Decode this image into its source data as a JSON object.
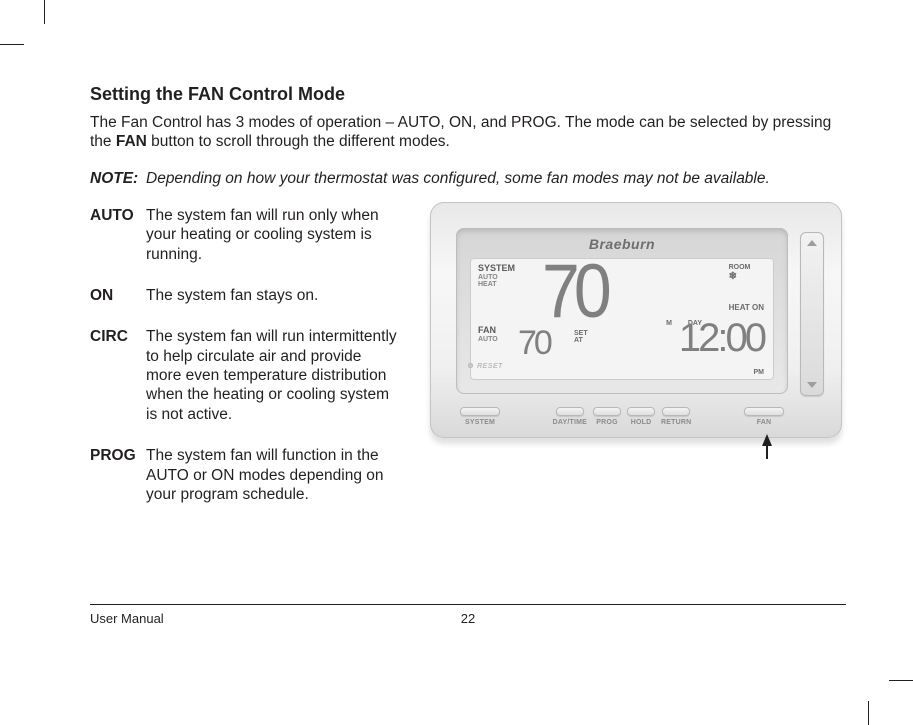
{
  "heading": "Setting the FAN Control Mode",
  "intro_pre": "The Fan Control has 3 modes of operation – AUTO, ON, and PROG. The mode can be selected by pressing the ",
  "intro_bold": "FAN",
  "intro_post": " button to scroll through the different modes.",
  "note_label": "NOTE:",
  "note_text": "Depending on how your thermostat was configured, some fan modes may not be available.",
  "defs": [
    {
      "term": "AUTO",
      "desc": "The system fan will run only when your heating or cooling system is running."
    },
    {
      "term": "ON",
      "desc": "The system fan stays on."
    },
    {
      "term": "CIRC",
      "desc": "The system fan will run intermittently to help circulate air and provide more even temperature distribution when the heating or cooling system is not active."
    },
    {
      "term": "PROG",
      "desc": "The system fan will function in the AUTO or ON modes depending on your program schedule."
    }
  ],
  "thermo": {
    "brand": "Braeburn",
    "reset": "RESET",
    "lcd": {
      "system_label": "SYSTEM",
      "system_auto": "AUTO",
      "system_heat": "HEAT",
      "fan_label": "FAN",
      "fan_mode": "AUTO",
      "big_temp": "70",
      "room_label": "ROOM",
      "heat_on": "HEAT ON",
      "small_temp": "70",
      "set_at_1": "SET",
      "set_at_2": "AT",
      "m_label": "M",
      "day_label": "DAY",
      "clock": "12:00",
      "pm": "PM"
    },
    "buttons": {
      "system": "SYSTEM",
      "daytime": "DAY/TIME",
      "prog": "PROG",
      "hold": "HOLD",
      "return": "RETURN",
      "fan": "FAN"
    }
  },
  "footer": {
    "doc": "User Manual",
    "page": "22"
  }
}
